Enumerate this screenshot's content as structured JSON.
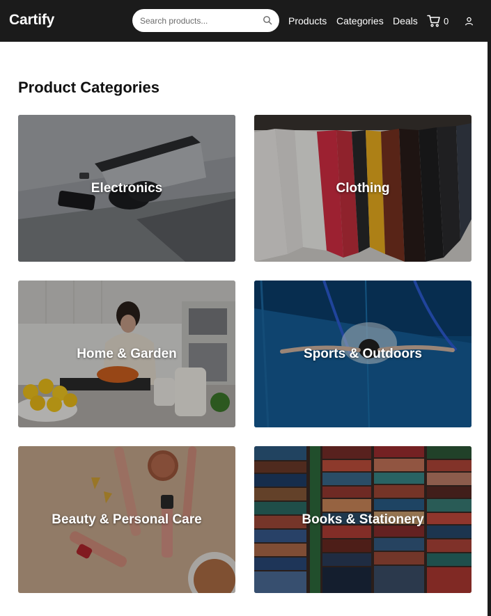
{
  "header": {
    "logo": "Cartify",
    "search_placeholder": "Search products...",
    "nav": [
      "Products",
      "Categories",
      "Deals"
    ],
    "cart_count": "0",
    "icons": {
      "search": "search-icon",
      "cart": "cart-icon",
      "user": "user-icon"
    }
  },
  "main": {
    "title": "Product Categories",
    "categories": [
      {
        "label": "Electronics",
        "image": "headphones-and-phone-on-desk"
      },
      {
        "label": "Clothing",
        "image": "shirts-on-rack"
      },
      {
        "label": "Home & Garden",
        "image": "woman-cooking-in-kitchen"
      },
      {
        "label": "Sports & Outdoors",
        "image": "swimmer-in-pool"
      },
      {
        "label": "Beauty & Personal Care",
        "image": "makeup-products"
      },
      {
        "label": "Books & Stationery",
        "image": "stacked-books"
      }
    ]
  },
  "colors": {
    "header_bg": "#1b1b1b",
    "page_bg": "#ffffff",
    "text": "#111111"
  }
}
